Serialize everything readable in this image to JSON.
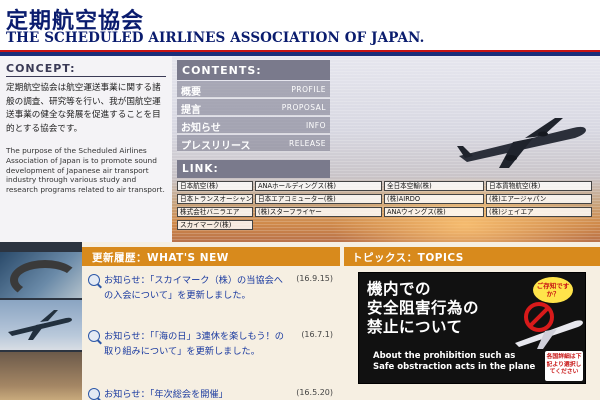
{
  "header": {
    "title_ja": "定期航空協会",
    "title_en": "THE SCHEDULED AIRLINES ASSOCIATION OF JAPAN."
  },
  "concept": {
    "heading": "CONCEPT:",
    "text_ja": "定期航空協会は航空運送事業に関する諸般の調査、研究等を行い、我が国航空運送事業の健全な発展を促進することを目的とする協会です。",
    "text_en": "The purpose of the Scheduled Airlines Association of Japan is to promote sound development of Japanese air transport industry through various study and research programs related to air transport."
  },
  "contents": {
    "heading": "CONTENTS:",
    "items": [
      {
        "ja": "概要",
        "en": "PROFILE"
      },
      {
        "ja": "提言",
        "en": "PROPOSAL"
      },
      {
        "ja": "お知らせ",
        "en": "INFO"
      },
      {
        "ja": "プレスリリース",
        "en": "RELEASE"
      }
    ]
  },
  "links": {
    "heading": "LINK:",
    "items": [
      "日本航空(株)",
      "ANAホールディングス(株)",
      "全日本空輸(株)",
      "日本貨物航空(株)",
      "日本トランスオーシャン(株)",
      "日本エアコミューター(株)",
      "(株)AIRDO",
      "(株)エアージャパン",
      "株式会社バニラエア",
      "(株)スターフライヤー",
      "ANAウイングス(株)",
      "(株)ジェイエア",
      "スカイマーク(株)"
    ]
  },
  "news": {
    "heading": "更新履歴：WHAT'S NEW",
    "items": [
      {
        "text": "お知らせ：「スカイマーク（株）の当協会への入会について」を更新しました。",
        "date": "(16.9.15)"
      },
      {
        "text": "お知らせ：「「海の日」3連休を楽しもう！の取り組みについて」を更新しました。",
        "date": "(16.7.1)"
      },
      {
        "text": "お知らせ：「年次総会を開催」",
        "date": "(16.5.20)"
      }
    ]
  },
  "topics": {
    "heading": "トピックス：TOPICS",
    "banner_line1": "機内での",
    "banner_line2": "安全阻害行為の",
    "banner_line3": "禁止について",
    "banner_en1": "About the prohibition such as",
    "banner_en2": "Safe obstraction acts in the plane",
    "bubble": "ご存知ですか？",
    "detail_badge": "各国詳細は下記より選択してください"
  },
  "colors": {
    "brand_blue": "#0a1c6e",
    "accent_red": "#c81414",
    "section_orange": "#d88a1c",
    "link_blue": "#1a3aa0"
  }
}
